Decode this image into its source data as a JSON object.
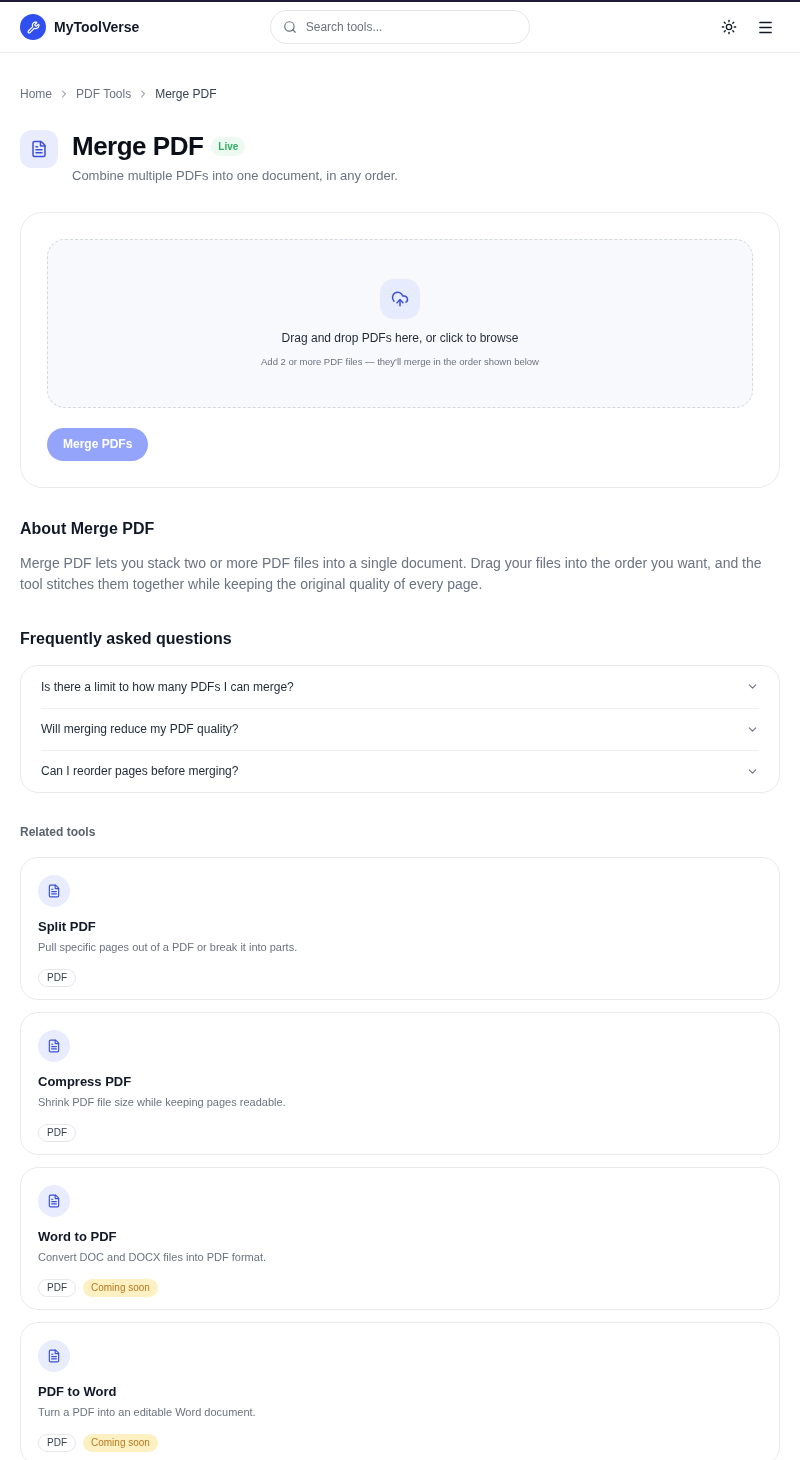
{
  "header": {
    "logo": "MyToolVerse",
    "search": {
      "placeholder": "Search tools..."
    }
  },
  "breadcrumb": [
    {
      "label": "Home",
      "current": false
    },
    {
      "label": "PDF Tools",
      "current": false
    },
    {
      "label": "Merge PDF",
      "current": true
    }
  ],
  "tool": {
    "title": "Merge PDF",
    "status": "Live",
    "subtitle": "Combine multiple PDFs into one document, in any order."
  },
  "upload": {
    "prompt": "Drag and drop PDFs here, or click to browse",
    "hint": "Add 2 or more PDF files — they'll merge in the order shown below",
    "button": {
      "label": "Merge PDFs",
      "disabled": true
    }
  },
  "about": {
    "heading": "About Merge PDF",
    "text": "Merge PDF lets you stack two or more PDF files into a single document. Drag your files into the order you want, and the tool stitches them together while keeping the original quality of every page."
  },
  "faq": {
    "heading": "Frequently asked questions",
    "items": [
      {
        "question": "Is there a limit to how many PDFs I can merge?",
        "expanded": false
      },
      {
        "question": "Will merging reduce my PDF quality?",
        "expanded": false
      },
      {
        "question": "Can I reorder pages before merging?",
        "expanded": false
      }
    ]
  },
  "related": {
    "heading": "Related tools",
    "tools": [
      {
        "name": "Split PDF",
        "description": "Pull specific pages out of a PDF or break it into parts.",
        "tags": [
          {
            "label": "PDF",
            "kind": "category"
          }
        ]
      },
      {
        "name": "Compress PDF",
        "description": "Shrink PDF file size while keeping pages readable.",
        "tags": [
          {
            "label": "PDF",
            "kind": "category"
          }
        ]
      },
      {
        "name": "Word to PDF",
        "description": "Convert DOC and DOCX files into PDF format.",
        "tags": [
          {
            "label": "PDF",
            "kind": "category"
          },
          {
            "label": "Coming soon",
            "kind": "status"
          }
        ]
      },
      {
        "name": "PDF to Word",
        "description": "Turn a PDF into an editable Word document.",
        "tags": [
          {
            "label": "PDF",
            "kind": "category"
          },
          {
            "label": "Coming soon",
            "kind": "status"
          }
        ]
      }
    ]
  }
}
